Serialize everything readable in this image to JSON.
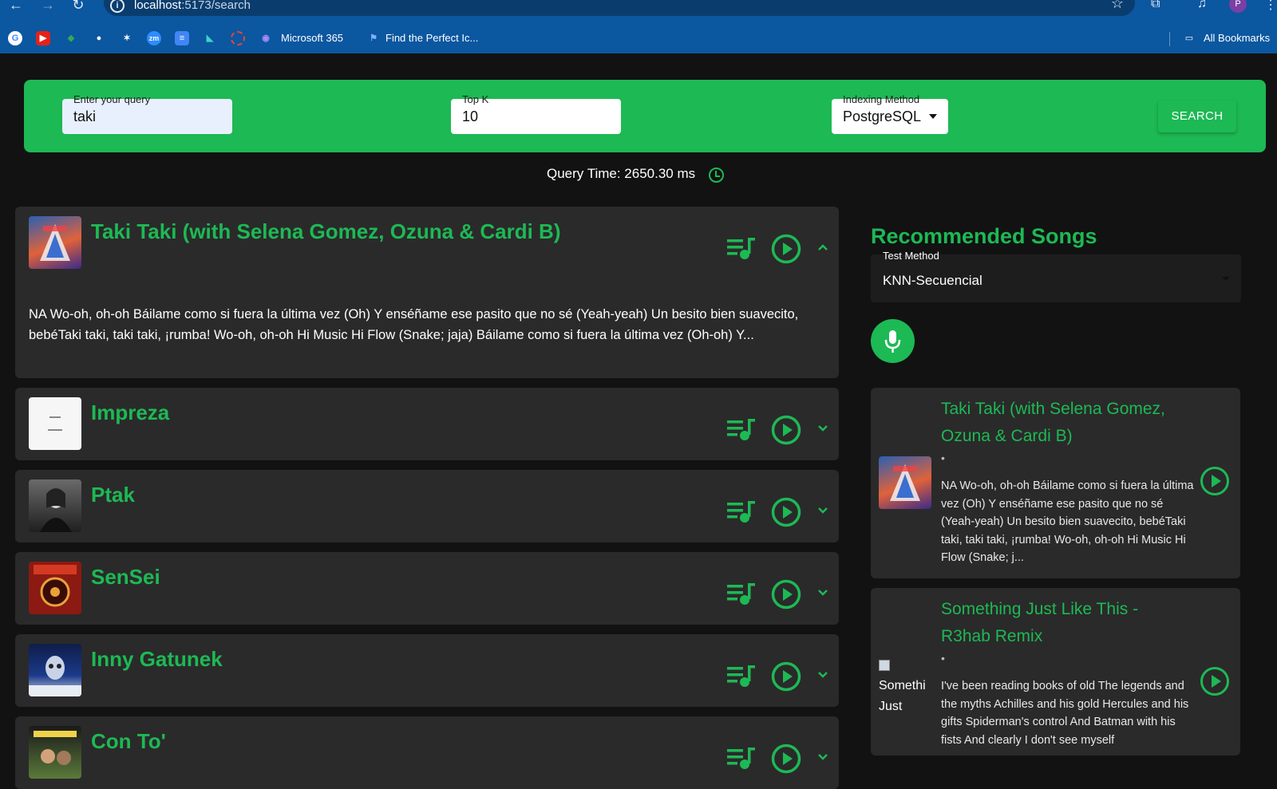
{
  "browser": {
    "url_host": "localhost",
    "url_path": ":5173/search",
    "bookmarks": [
      "Microsoft 365",
      "Find the Perfect Ic..."
    ],
    "all_bookmarks": "All Bookmarks",
    "profile_initial": "P"
  },
  "search": {
    "query_label": "Enter your query",
    "query_value": "taki",
    "topk_label": "Top K",
    "topk_value": "10",
    "method_label": "Indexing Method",
    "method_value": "PostgreSQL",
    "search_button": "SEARCH"
  },
  "query_time": "Query Time: 2650.30 ms",
  "results": [
    {
      "title": "Taki Taki (with Selena Gomez, Ozuna & Cardi B)",
      "expanded": true,
      "lyrics": "NA Wo-oh, oh-oh Báilame como si fuera la última vez (Oh) Y enséñame ese pasito que no sé (Yeah-yeah) Un besito bien suavecito, bebéTaki taki, taki taki, ¡rumba! Wo-oh, oh-oh Hi Music Hi Flow (Snake; jaja) Báilame como si fuera la última vez (Oh-oh) Y..."
    },
    {
      "title": "Impreza",
      "expanded": false
    },
    {
      "title": "Ptak",
      "expanded": false
    },
    {
      "title": "SenSei",
      "expanded": false
    },
    {
      "title": "Inny Gatunek",
      "expanded": false
    },
    {
      "title": "Con To'",
      "expanded": false
    }
  ],
  "recommendations": {
    "heading": "Recommended Songs",
    "test_method_label": "Test Method",
    "test_method_value": "KNN-Secuencial",
    "songs": [
      {
        "title": "Taki Taki (with Selena Gomez, Ozuna & Cardi B)",
        "dot": "•",
        "lyrics": "NA Wo-oh, oh-oh Báilame como si fuera la última vez (Oh) Y enséñame ese pasito que no sé (Yeah-yeah) Un besito bien suavecito, bebéTaki taki, taki taki, ¡rumba! Wo-oh, oh-oh Hi Music Hi Flow (Snake; j..."
      },
      {
        "title": "Something Just Like This - R3hab Remix",
        "alt_text": "Somethi Just",
        "dot": "•",
        "lyrics": "I've been reading books of old The legends and the myths Achilles and his gold Hercules and his gifts Spiderman's control And Batman with his fists And clearly I don't see myself"
      }
    ]
  },
  "colors": {
    "accent": "#1db954",
    "background": "#121212",
    "card": "#2a2a2a",
    "browser_bar": "#0b57a0"
  }
}
